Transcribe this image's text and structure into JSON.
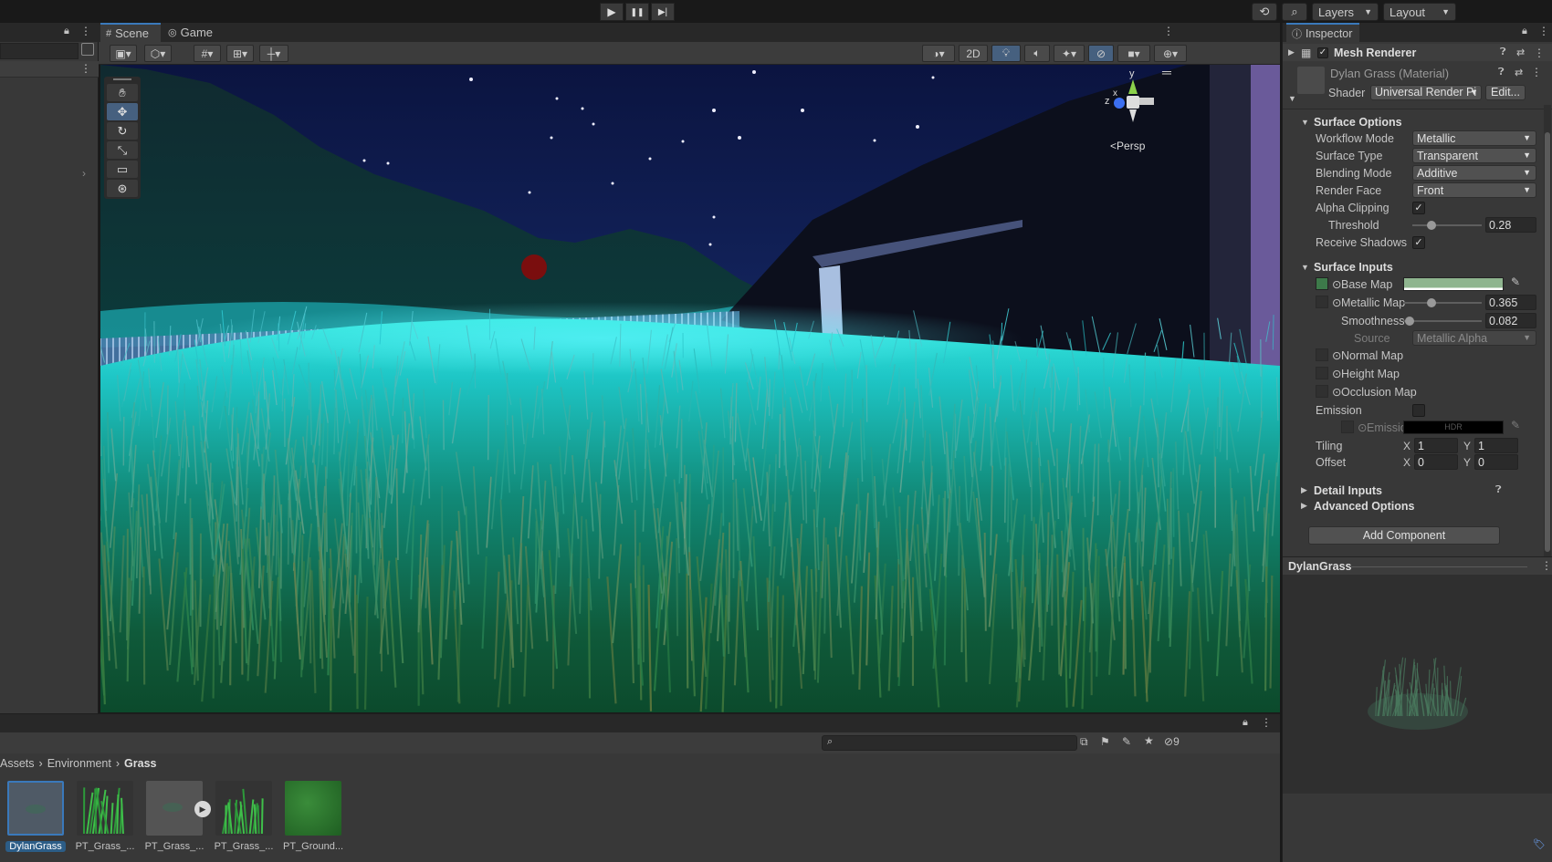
{
  "toolbar": {
    "play": "▶",
    "pause": "❚❚",
    "step": "▶|",
    "layers": "Layers",
    "layout": "Layout"
  },
  "tabs": {
    "scene": "Scene",
    "game": "Game"
  },
  "scene_bar": {
    "mode_2d": "2D",
    "persp": "Persp",
    "gizmo_x": "x",
    "gizmo_y": "y",
    "gizmo_z": "z"
  },
  "inspector": {
    "tab": "Inspector",
    "component": "Mesh Renderer",
    "material_name": "Dylan Grass (Material)",
    "shader_label": "Shader",
    "shader_value": "Universal Render Pi",
    "edit_button": "Edit...",
    "surface_options": {
      "title": "Surface Options",
      "workflow_label": "Workflow Mode",
      "workflow_value": "Metallic",
      "surface_type_label": "Surface Type",
      "surface_type_value": "Transparent",
      "blending_label": "Blending Mode",
      "blending_value": "Additive",
      "render_face_label": "Render Face",
      "render_face_value": "Front",
      "alpha_clip_label": "Alpha Clipping",
      "alpha_clip_checked": true,
      "threshold_label": "Threshold",
      "threshold_value": "0.28",
      "threshold_fraction": 0.28,
      "receive_shadows_label": "Receive Shadows",
      "receive_shadows_checked": true
    },
    "surface_inputs": {
      "title": "Surface Inputs",
      "base_map_label": "Base Map",
      "metallic_label": "Metallic Map",
      "metallic_value": "0.365",
      "metallic_fraction": 0.365,
      "smoothness_label": "Smoothness",
      "smoothness_value": "0.082",
      "smoothness_fraction": 0.082,
      "source_label": "Source",
      "source_value": "Metallic Alpha",
      "normal_label": "Normal Map",
      "height_label": "Height Map",
      "occlusion_label": "Occlusion Map",
      "emission_label": "Emission",
      "emission_map_label": "Emission",
      "hdr_label": "HDR",
      "tiling_label": "Tiling",
      "offset_label": "Offset",
      "tiling_x": "1",
      "tiling_y": "1",
      "offset_x": "0",
      "offset_y": "0",
      "x_label": "X",
      "y_label": "Y"
    },
    "detail_inputs": "Detail Inputs",
    "advanced_options": "Advanced Options",
    "add_component": "Add Component",
    "preview_title": "DylanGrass"
  },
  "project": {
    "breadcrumb": [
      "Assets",
      "Environment",
      "Grass"
    ],
    "hidden_count": "9",
    "assets": [
      {
        "label": "DylanGrass",
        "selected": true
      },
      {
        "label": "PT_Grass_...",
        "selected": false
      },
      {
        "label": "PT_Grass_...",
        "selected": false
      },
      {
        "label": "PT_Grass_...",
        "selected": false
      },
      {
        "label": "PT_Ground...",
        "selected": false
      }
    ]
  }
}
